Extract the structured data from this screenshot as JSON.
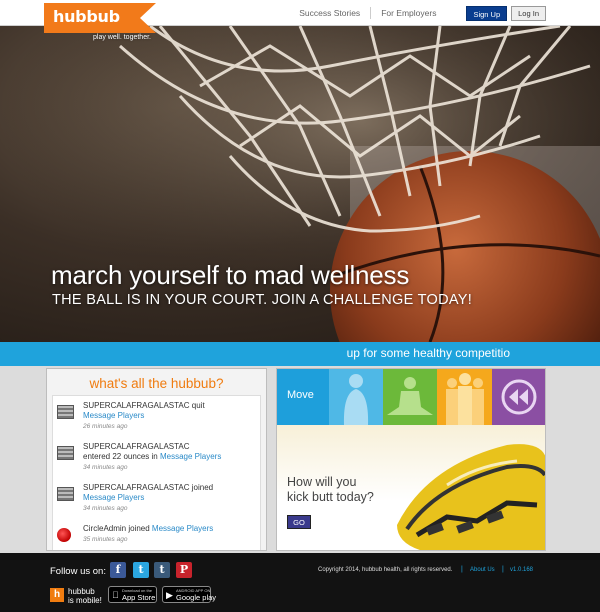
{
  "header": {
    "logo_text": "hubbub",
    "tagline": "play well. together.",
    "nav": {
      "success_stories": "Success Stories",
      "for_employers": "For Employers",
      "sign_up": "Sign Up",
      "log_in": "Log In"
    }
  },
  "hero": {
    "title": "march yourself to mad wellness",
    "subtitle": "THE BALL IS IN YOUR COURT. JOIN A CHALLENGE TODAY!"
  },
  "banner": {
    "text": "up for some healthy competitio"
  },
  "feed": {
    "title": "what's all the hubbub?",
    "items": [
      {
        "user": "SUPERCALAFRAGALASTAC",
        "action": " quit",
        "link": "Message Players",
        "time": "26 minutes ago"
      },
      {
        "user": "SUPERCALAFRAGALASTAC",
        "action": "entered 22 ounces in ",
        "link": "Message Players",
        "time": "34 minutes ago"
      },
      {
        "user": "SUPERCALAFRAGALASTAC",
        "action": " joined",
        "link": "Message Players",
        "time": "34 minutes ago"
      },
      {
        "user": "CircleAdmin",
        "action": " joined ",
        "link": "Message Players",
        "time": "35 minutes ago"
      }
    ]
  },
  "promo": {
    "tile_label": "Move",
    "question_line1": "How will you",
    "question_line2": "kick butt today?",
    "go_label": "GO",
    "colors": {
      "move": "#1e9fdb",
      "tile_a": "#4fb8e6",
      "tile_b": "#6cb93a",
      "tile_c": "#f5a81c",
      "tile_d": "#8b4fa3"
    }
  },
  "footer": {
    "follow_label": "Follow us on:",
    "social": {
      "facebook": "f",
      "twitter": "t",
      "tumblr": "t",
      "pinterest": "P"
    },
    "mobile_icon": "h",
    "mobile_line1": "hubbub",
    "mobile_line2": "is mobile!",
    "app_store_small": "Download on the",
    "app_store": "App Store",
    "google_play_small": "ANDROID APP ON",
    "google_play": "Google play",
    "copyright": "Copyright 2014, hubbub health, all rights reserved.",
    "separator": "|",
    "about": "About Us",
    "version": "v1.0.168"
  }
}
